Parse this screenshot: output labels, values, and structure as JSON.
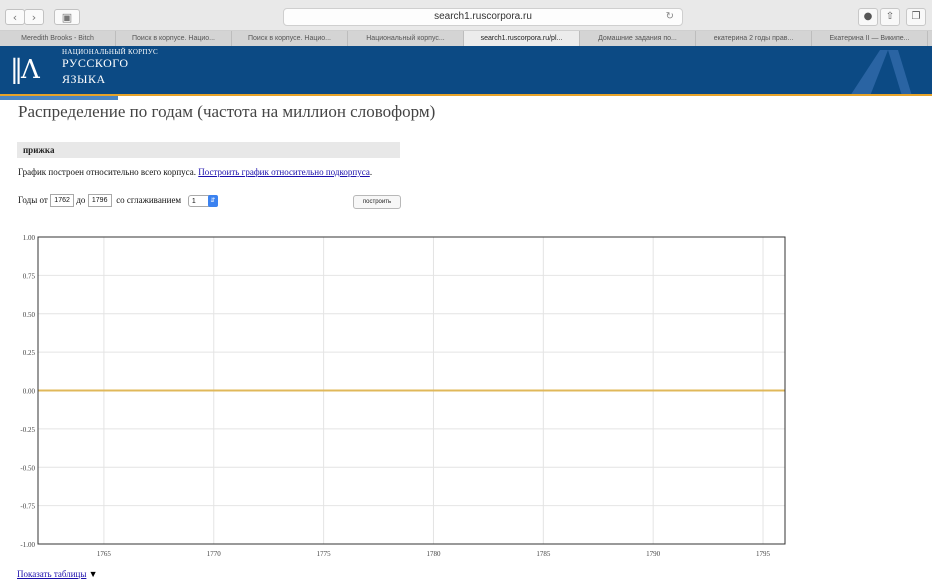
{
  "browser": {
    "url": "search1.ruscorpora.ru",
    "tabs": [
      {
        "label": "Meredith Brooks - Bitch"
      },
      {
        "label": "Поиск в корпусе. Нацио..."
      },
      {
        "label": "Поиск в корпусе. Нацио..."
      },
      {
        "label": "Национальный корпус..."
      },
      {
        "label": "search1.ruscorpora.ru/pl..."
      },
      {
        "label": "Домашние задания по..."
      },
      {
        "label": "екатерина 2 годы прав..."
      },
      {
        "label": "Екатерина II — Википе..."
      }
    ],
    "active_tab": 4
  },
  "site": {
    "brand_line1": "НАЦИОНАЛЬНЫЙ КОРПУС",
    "brand_line2": "РУССКОГО",
    "brand_line3": "ЯЗЫКА",
    "colors": {
      "header": "#0c4a84",
      "stripe": "#e6a32a",
      "link": "#1a0dab"
    }
  },
  "page": {
    "title": "Распределение по годам (частота на миллион словоформ)",
    "query": "прижка",
    "info_text": "График построен относительно всего корпуса.",
    "info_link": "Построить график относительно подкорпуса",
    "info_tail": ".",
    "years_from_label": "Годы от",
    "years_from": "1762",
    "years_to_label": "до",
    "years_to": "1796",
    "smoothing_label": "со сглаживанием",
    "smoothing_value": "1",
    "build_button": "построить",
    "show_table_link": "Показать таблицы",
    "show_table_arrow": "▼"
  },
  "chart_data": {
    "type": "line",
    "x_start": 1762,
    "x_end": 1796,
    "xticks": [
      "1765",
      "1770",
      "1775",
      "1780",
      "1785",
      "1790",
      "1795"
    ],
    "yticks": [
      "1.00",
      "0.75",
      "0.50",
      "0.25",
      "0.00",
      "-0.25",
      "-0.50",
      "-0.75",
      "-1.00"
    ],
    "ylim": [
      -1,
      1
    ],
    "series": [
      {
        "color": "#e0b85a",
        "values": [
          0,
          0,
          0,
          0,
          0,
          0,
          0,
          0,
          0,
          0,
          0,
          0,
          0,
          0,
          0,
          0,
          0,
          0,
          0,
          0,
          0,
          0,
          0,
          0,
          0,
          0,
          0,
          0,
          0,
          0,
          0,
          0,
          0,
          0,
          0
        ]
      }
    ],
    "grid": true
  }
}
